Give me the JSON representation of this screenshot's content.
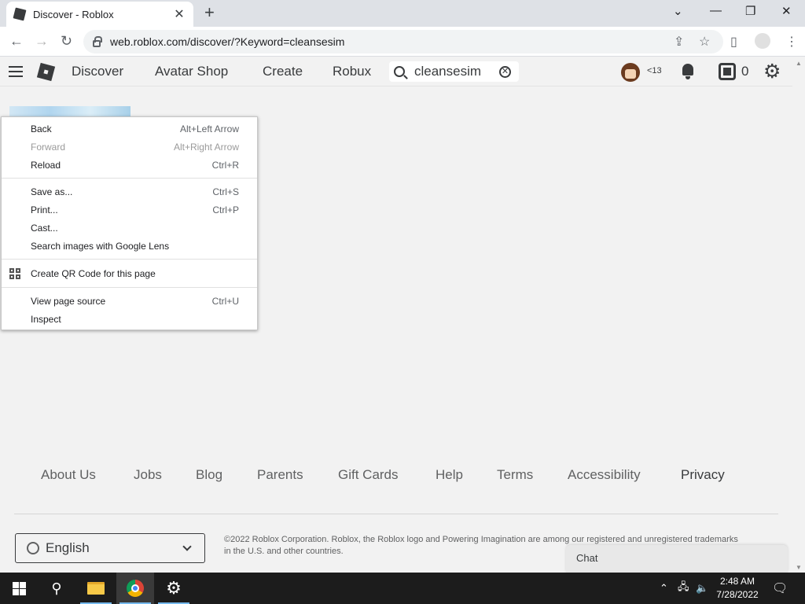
{
  "browser": {
    "tab_title": "Discover - Roblox",
    "url": "web.roblox.com/discover/?Keyword=cleansesim"
  },
  "nav": {
    "links": [
      "Discover",
      "Avatar Shop",
      "Create",
      "Robux"
    ],
    "search_value": "cleansesim",
    "age_label": "<13",
    "robux_count": "0"
  },
  "context_menu": {
    "items": [
      {
        "label": "Back",
        "shortcut": "Alt+Left Arrow",
        "disabled": false
      },
      {
        "label": "Forward",
        "shortcut": "Alt+Right Arrow",
        "disabled": true
      },
      {
        "label": "Reload",
        "shortcut": "Ctrl+R",
        "disabled": false
      },
      {
        "label": "Save as...",
        "shortcut": "Ctrl+S",
        "disabled": false
      },
      {
        "label": "Print...",
        "shortcut": "Ctrl+P",
        "disabled": false
      },
      {
        "label": "Cast...",
        "shortcut": "",
        "disabled": false
      },
      {
        "label": "Search images with Google Lens",
        "shortcut": "",
        "disabled": false
      },
      {
        "label": "Create QR Code for this page",
        "shortcut": "",
        "disabled": false
      },
      {
        "label": "View page source",
        "shortcut": "Ctrl+U",
        "disabled": false
      },
      {
        "label": "Inspect",
        "shortcut": "",
        "disabled": false
      }
    ]
  },
  "footer": {
    "links": [
      "About Us",
      "Jobs",
      "Blog",
      "Parents",
      "Gift Cards",
      "Help",
      "Terms",
      "Accessibility",
      "Privacy"
    ],
    "language": "English",
    "copyright": "©2022 Roblox Corporation. Roblox, the Roblox logo and Powering Imagination are among our registered and unregistered trademarks in the U.S. and other countries."
  },
  "chat": {
    "label": "Chat"
  },
  "taskbar": {
    "time": "2:48 AM",
    "date": "7/28/2022"
  }
}
